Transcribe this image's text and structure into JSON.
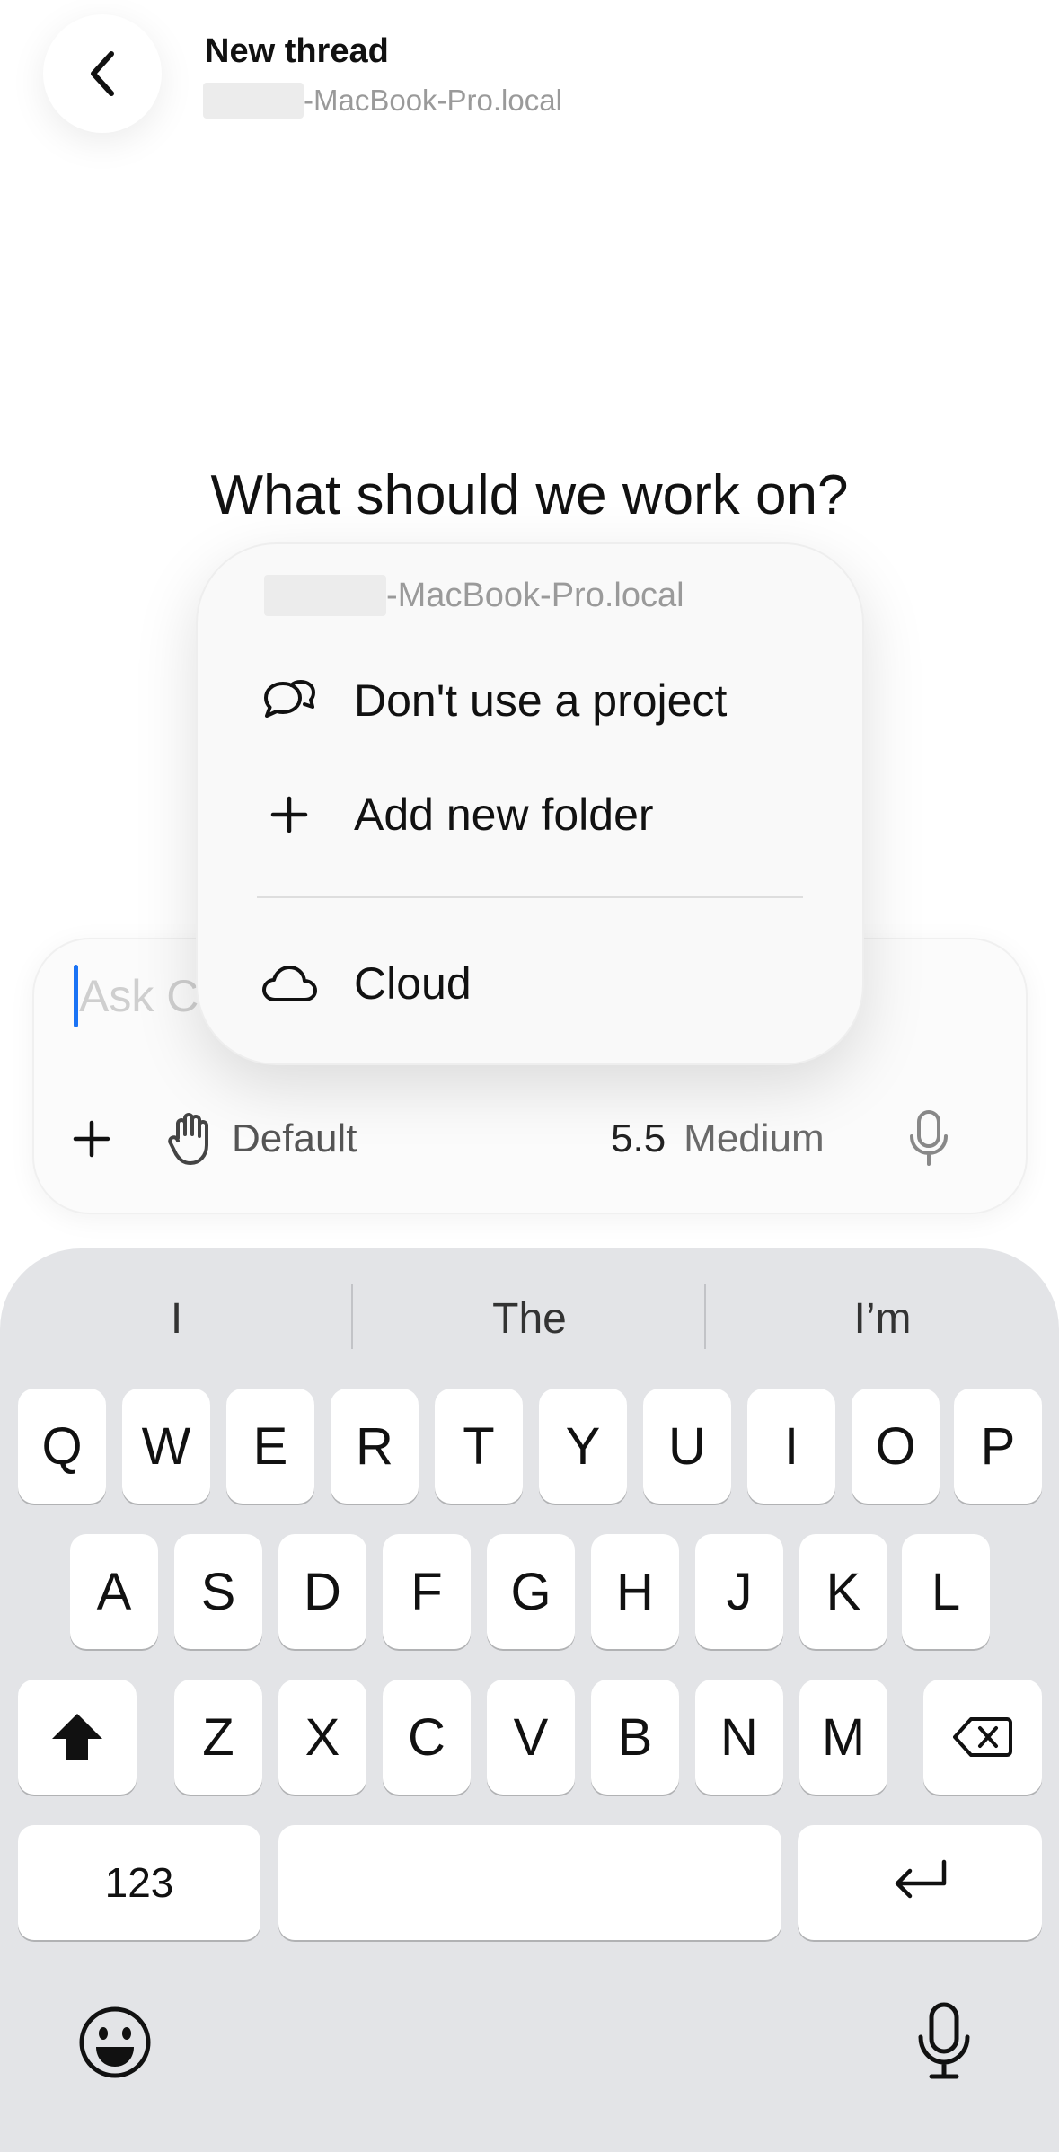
{
  "header": {
    "title": "New thread",
    "subtitle": "-MacBook-Pro.local"
  },
  "main": {
    "heading": "What should we work on?"
  },
  "composer": {
    "placeholder": "Ask C",
    "mode_label": "Default",
    "model_version": "5.5",
    "model_effort": "Medium"
  },
  "project_menu": {
    "host": "-MacBook-Pro.local",
    "items": [
      {
        "label": "Don't use a project",
        "icon": "chat-bubbles-icon"
      },
      {
        "label": "Add new folder",
        "icon": "plus-icon"
      },
      {
        "label": "Cloud",
        "icon": "cloud-icon"
      }
    ]
  },
  "keyboard": {
    "suggestions": [
      "I",
      "The",
      "I’m"
    ],
    "row1": [
      "Q",
      "W",
      "E",
      "R",
      "T",
      "Y",
      "U",
      "I",
      "O",
      "P"
    ],
    "row2": [
      "A",
      "S",
      "D",
      "F",
      "G",
      "H",
      "J",
      "K",
      "L"
    ],
    "row3": [
      "Z",
      "X",
      "C",
      "V",
      "B",
      "N",
      "M"
    ],
    "numbers_key": "123"
  },
  "colors": {
    "caret": "#1a73f5",
    "keyboard_bg": "#e3e4e7"
  }
}
